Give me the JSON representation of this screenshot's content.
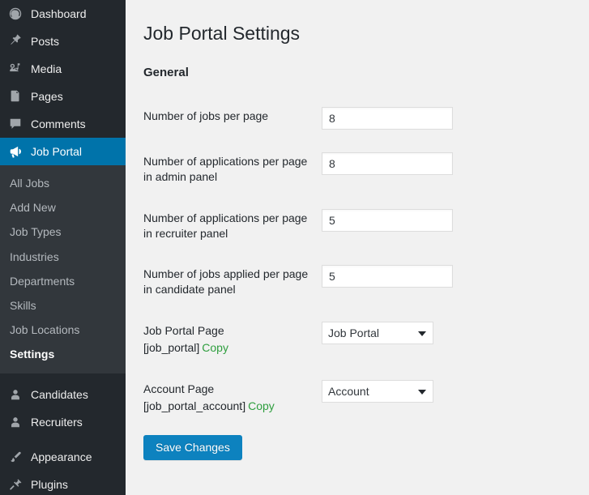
{
  "sidebar": {
    "items": [
      {
        "label": "Dashboard",
        "icon": "dashboard-icon",
        "current": false
      },
      {
        "label": "Posts",
        "icon": "pin-icon",
        "current": false
      },
      {
        "label": "Media",
        "icon": "media-icon",
        "current": false
      },
      {
        "label": "Pages",
        "icon": "pages-icon",
        "current": false
      },
      {
        "label": "Comments",
        "icon": "comments-icon",
        "current": false
      },
      {
        "label": "Job Portal",
        "icon": "megaphone-icon",
        "current": true
      }
    ],
    "submenu": [
      {
        "label": "All Jobs",
        "active": false
      },
      {
        "label": "Add New",
        "active": false
      },
      {
        "label": "Job Types",
        "active": false
      },
      {
        "label": "Industries",
        "active": false
      },
      {
        "label": "Departments",
        "active": false
      },
      {
        "label": "Skills",
        "active": false
      },
      {
        "label": "Job Locations",
        "active": false
      },
      {
        "label": "Settings",
        "active": true
      }
    ],
    "items_lower": [
      {
        "label": "Candidates",
        "icon": "user-icon",
        "current": false
      },
      {
        "label": "Recruiters",
        "icon": "user-icon",
        "current": false
      }
    ],
    "items_footer": [
      {
        "label": "Appearance",
        "icon": "paintbrush-icon",
        "current": false
      },
      {
        "label": "Plugins",
        "icon": "plug-icon",
        "current": false
      }
    ]
  },
  "main": {
    "page_title": "Job Portal Settings",
    "section_title": "General",
    "fields": [
      {
        "label": "Number of jobs per page",
        "value": "8",
        "type": "text"
      },
      {
        "label": "Number of applications per page in admin panel",
        "value": "8",
        "type": "text"
      },
      {
        "label": "Number of applications per page in recruiter panel",
        "value": "5",
        "type": "text"
      },
      {
        "label": "Number of jobs applied per page in candidate panel",
        "value": "5",
        "type": "text"
      }
    ],
    "page_fields": [
      {
        "label": "Job Portal Page",
        "shortcode": "[job_portal]",
        "copy_label": "Copy",
        "value": "Job Portal",
        "options": [
          "Job Portal"
        ]
      },
      {
        "label": "Account Page",
        "shortcode": "[job_portal_account]",
        "copy_label": "Copy",
        "value": "Account",
        "options": [
          "Account"
        ]
      }
    ],
    "save_label": "Save Changes"
  },
  "colors": {
    "sidebar_bg": "#23282d",
    "submenu_bg": "#32373c",
    "accent": "#0073aa",
    "button": "#0d82bf",
    "copy_link": "#2e9e3e",
    "page_bg": "#f1f1f1"
  }
}
